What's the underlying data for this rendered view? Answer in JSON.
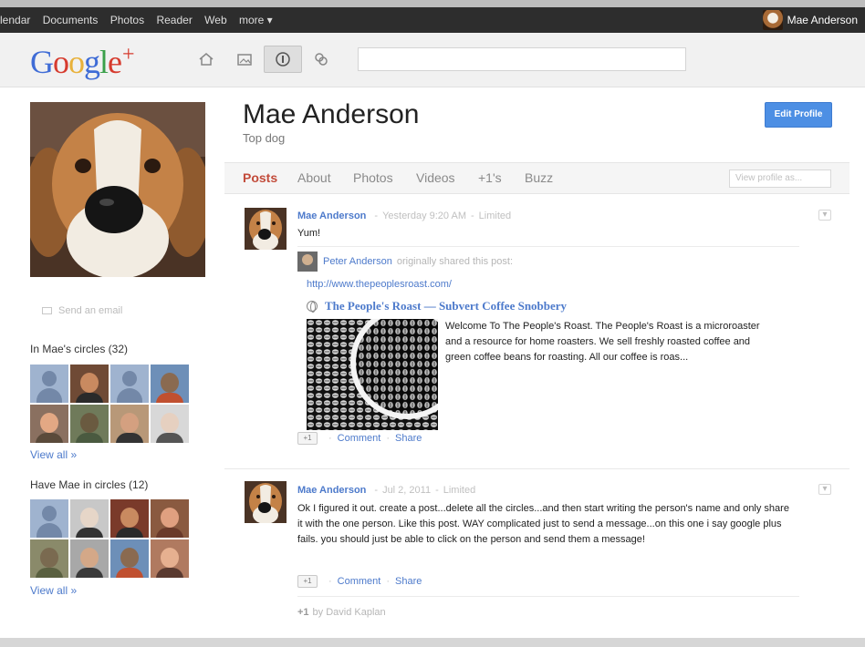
{
  "topbar": {
    "nav": [
      "lendar",
      "Documents",
      "Photos",
      "Reader",
      "Web",
      "more ▾"
    ],
    "user_name": "Mae Anderson",
    "user_caret": "▾"
  },
  "header": {
    "logo": {
      "g1": "G",
      "o1": "o",
      "o2": "o",
      "g2": "g",
      "l": "l",
      "e": "e",
      "plus": "+"
    },
    "nav_icons": [
      "home-icon",
      "photos-icon",
      "profile-icon",
      "circles-icon"
    ],
    "active_icon": "profile-icon"
  },
  "sidebar": {
    "email_label": "Send an email",
    "in_circles_title": "In Mae's circles (32)",
    "have_in_circles_title": "Have Mae in circles (12)",
    "view_all": "View all »"
  },
  "profile": {
    "name": "Mae Anderson",
    "tagline": "Top dog",
    "edit_button": "Edit Profile"
  },
  "tabs": [
    {
      "label": "Posts",
      "active": true
    },
    {
      "label": "About",
      "active": false
    },
    {
      "label": "Photos",
      "active": false
    },
    {
      "label": "Videos",
      "active": false
    },
    {
      "label": "+1's",
      "active": false
    },
    {
      "label": "Buzz",
      "active": false
    }
  ],
  "view_as_placeholder": "View profile as...",
  "posts": [
    {
      "author": "Mae Anderson",
      "time": "Yesterday 9:20 AM",
      "visibility": "Limited",
      "text": "Yum!",
      "shared_by": "Peter Anderson",
      "shared_note": "originally shared this post:",
      "link_url": "http://www.thepeoplesroast.com/",
      "link_title": "The People's Roast — Subvert Coffee Snobbery",
      "link_desc": "Welcome To The People's Roast. The People's Roast is a microroaster and a resource for home roasters. We sell freshly roasted coffee and green coffee beans for roasting. All our coffee is roas..."
    },
    {
      "author": "Mae Anderson",
      "time": "Jul 2, 2011",
      "visibility": "Limited",
      "text": "Ok I figured it out. create a post...delete all the circles...and then start writing the person's name and only share it with the one person. Like this post. WAY complicated just to send a message...on this one i say google plus fails. you should just be able to click on the person and send them a message!",
      "plusone_by": "by David Kaplan"
    }
  ],
  "actions": {
    "plusone": "+1",
    "comment": "Comment",
    "share": "Share",
    "dot": "·",
    "sep": "-",
    "plusone_prefix": "+1"
  },
  "colors": {
    "link_blue": "#4d7acb",
    "active_tab": "#c24b3a",
    "edit_button": "#4d8fe4",
    "topbar": "#2d2d2d"
  }
}
